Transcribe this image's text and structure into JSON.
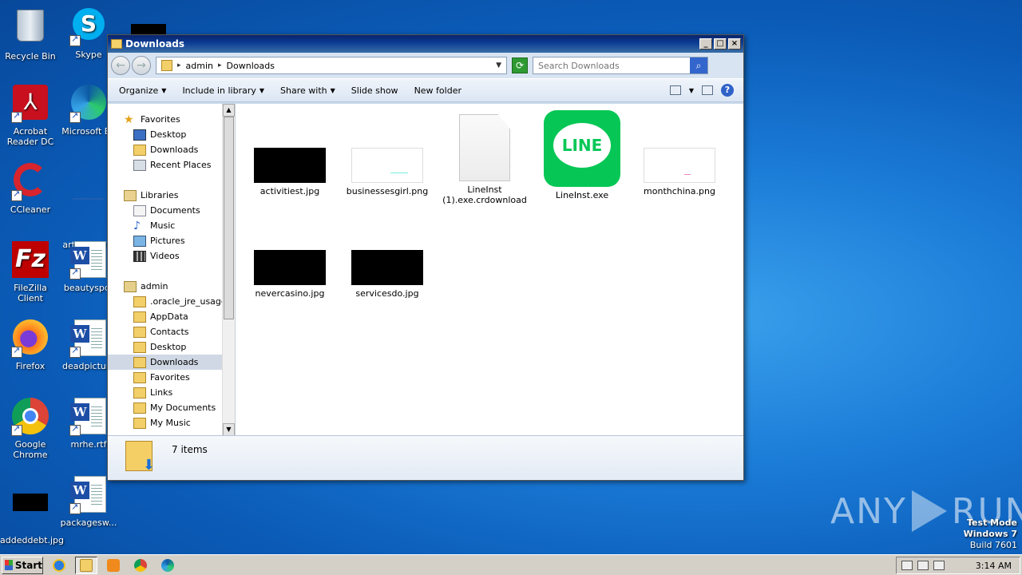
{
  "desktop": {
    "icons": [
      {
        "label": "Recycle Bin"
      },
      {
        "label": "Skype"
      },
      {
        "label": "Acrobat Reader DC"
      },
      {
        "label": "Microsoft Ed"
      },
      {
        "label": "CCleaner"
      },
      {
        "label": "artistsquest"
      },
      {
        "label": "FileZilla Client"
      },
      {
        "label": "beautyspor"
      },
      {
        "label": "Firefox"
      },
      {
        "label": "deadpicture"
      },
      {
        "label": "Google Chrome"
      },
      {
        "label": "mrhe.rtf"
      },
      {
        "label": "addeddebt.jpg"
      },
      {
        "label": "packagesw..."
      }
    ]
  },
  "window": {
    "title": "Downloads",
    "controls": {
      "minimize": "_",
      "maximize": "□",
      "close": "×"
    },
    "address": {
      "crumbs": [
        "admin",
        "Downloads"
      ]
    },
    "search": {
      "placeholder": "Search Downloads"
    },
    "toolbar": {
      "organize": "Organize",
      "include_in_library": "Include in library",
      "share_with": "Share with",
      "slide_show": "Slide show",
      "new_folder": "New folder"
    },
    "nav": {
      "favorites_header": "Favorites",
      "favorites": [
        "Desktop",
        "Downloads",
        "Recent Places"
      ],
      "libraries_header": "Libraries",
      "libraries": [
        "Documents",
        "Music",
        "Pictures",
        "Videos"
      ],
      "user_header": "admin",
      "user_folders": [
        ".oracle_jre_usage",
        "AppData",
        "Contacts",
        "Desktop",
        "Downloads",
        "Favorites",
        "Links",
        "My Documents",
        "My Music"
      ],
      "selected": "Downloads"
    },
    "files": [
      {
        "name": "activitiest.jpg"
      },
      {
        "name": "businessesgirl.png"
      },
      {
        "name": "LineInst (1).exe.crdownload"
      },
      {
        "name": "LineInst.exe",
        "icon_text": "LINE"
      },
      {
        "name": "monthchina.png"
      },
      {
        "name": "nevercasino.jpg"
      },
      {
        "name": "servicesdo.jpg"
      }
    ],
    "status": {
      "count": "7 items"
    }
  },
  "taskbar": {
    "start": "Start",
    "clock": "3:14 AM"
  },
  "watermark": {
    "test_mode": "Test Mode",
    "os": "Windows 7",
    "build": "Build 7601",
    "anyrun_left": "ANY",
    "anyrun_right": "RUN"
  },
  "colors": {
    "line_green": "#06c755",
    "title_blue": "#0a246a"
  }
}
